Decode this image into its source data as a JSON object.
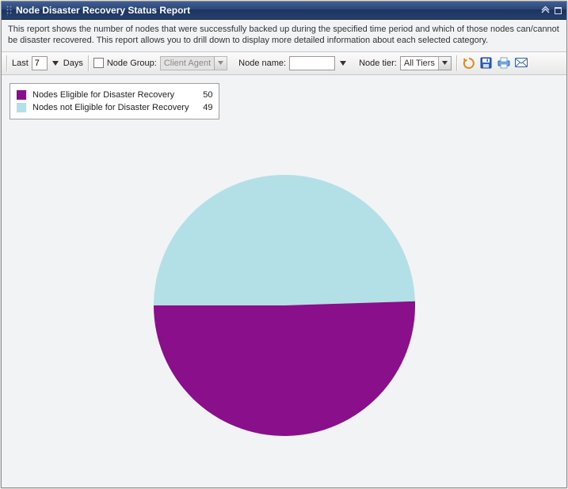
{
  "header": {
    "title": "Node Disaster Recovery Status Report"
  },
  "description": "This report shows the number of nodes that were successfully backed up during the specified time period and which of those nodes can/cannot be disaster recovered. This report allows you to drill down to display more detailed information about each selected category.",
  "toolbar": {
    "last_label": "Last",
    "last_value": "7",
    "days_label": "Days",
    "node_group_label": "Node Group:",
    "node_group_value": "Client Agent",
    "node_name_label": "Node name:",
    "node_name_value": "",
    "node_tier_label": "Node tier:",
    "node_tier_value": "All Tiers"
  },
  "legend": {
    "items": [
      {
        "label": "Nodes Eligible for Disaster Recovery",
        "value": "50",
        "color": "#8a0f8a"
      },
      {
        "label": "Nodes not Eligible for Disaster Recovery",
        "value": "49",
        "color": "#b3e0e6"
      }
    ]
  },
  "chart_data": {
    "type": "pie",
    "title": "Node Disaster Recovery Status Report",
    "series": [
      {
        "name": "Nodes Eligible for Disaster Recovery",
        "value": 50,
        "color": "#8a0f8a"
      },
      {
        "name": "Nodes not Eligible for Disaster Recovery",
        "value": 49,
        "color": "#b3e0e6"
      }
    ]
  }
}
